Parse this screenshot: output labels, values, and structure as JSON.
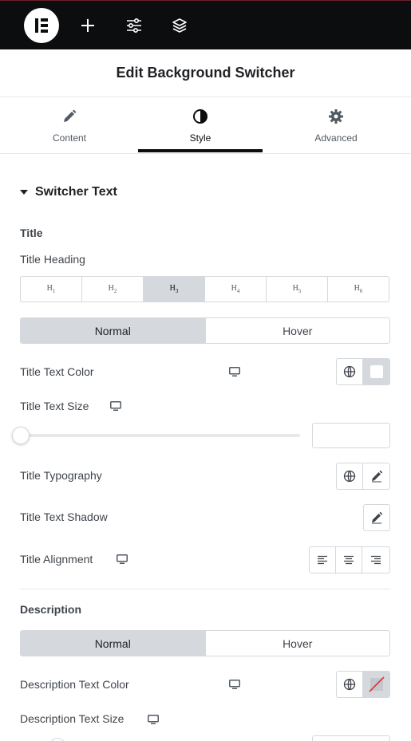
{
  "topbar": {
    "icons": [
      "elementor-logo-icon",
      "plus-icon",
      "sliders-icon",
      "layers-icon"
    ]
  },
  "header": {
    "title": "Edit Background Switcher"
  },
  "tabs": [
    {
      "label": "Content",
      "icon": "pencil-icon"
    },
    {
      "label": "Style",
      "icon": "half-circle-icon",
      "active": true
    },
    {
      "label": "Advanced",
      "icon": "gear-icon"
    }
  ],
  "section": {
    "title": "Switcher Text"
  },
  "title_group": {
    "heading": "Title",
    "title_heading_label": "Title Heading",
    "heading_options": [
      "H1",
      "H2",
      "H3",
      "H4",
      "H5",
      "H6"
    ],
    "heading_selected": "H3",
    "state_tabs": [
      "Normal",
      "Hover"
    ],
    "state_selected": "Normal",
    "text_color_label": "Title Text Color",
    "text_color_value": "#ffffff",
    "text_size_label": "Title Text Size",
    "text_size_value": "",
    "typography_label": "Title Typography",
    "text_shadow_label": "Title Text Shadow",
    "alignment_label": "Title Alignment",
    "alignment_options": [
      "align-left-icon",
      "align-center-icon",
      "align-right-icon"
    ]
  },
  "description_group": {
    "heading": "Description",
    "state_tabs": [
      "Normal",
      "Hover"
    ],
    "state_selected": "Normal",
    "text_color_label": "Description Text Color",
    "text_color_value": "none",
    "text_size_label": "Description Text Size"
  },
  "colors": {
    "topbar_bg": "#0c0d0e",
    "selected_bg": "#d5d8dc",
    "border": "#d5d8dc",
    "no_color_slash": "#e0353c"
  }
}
